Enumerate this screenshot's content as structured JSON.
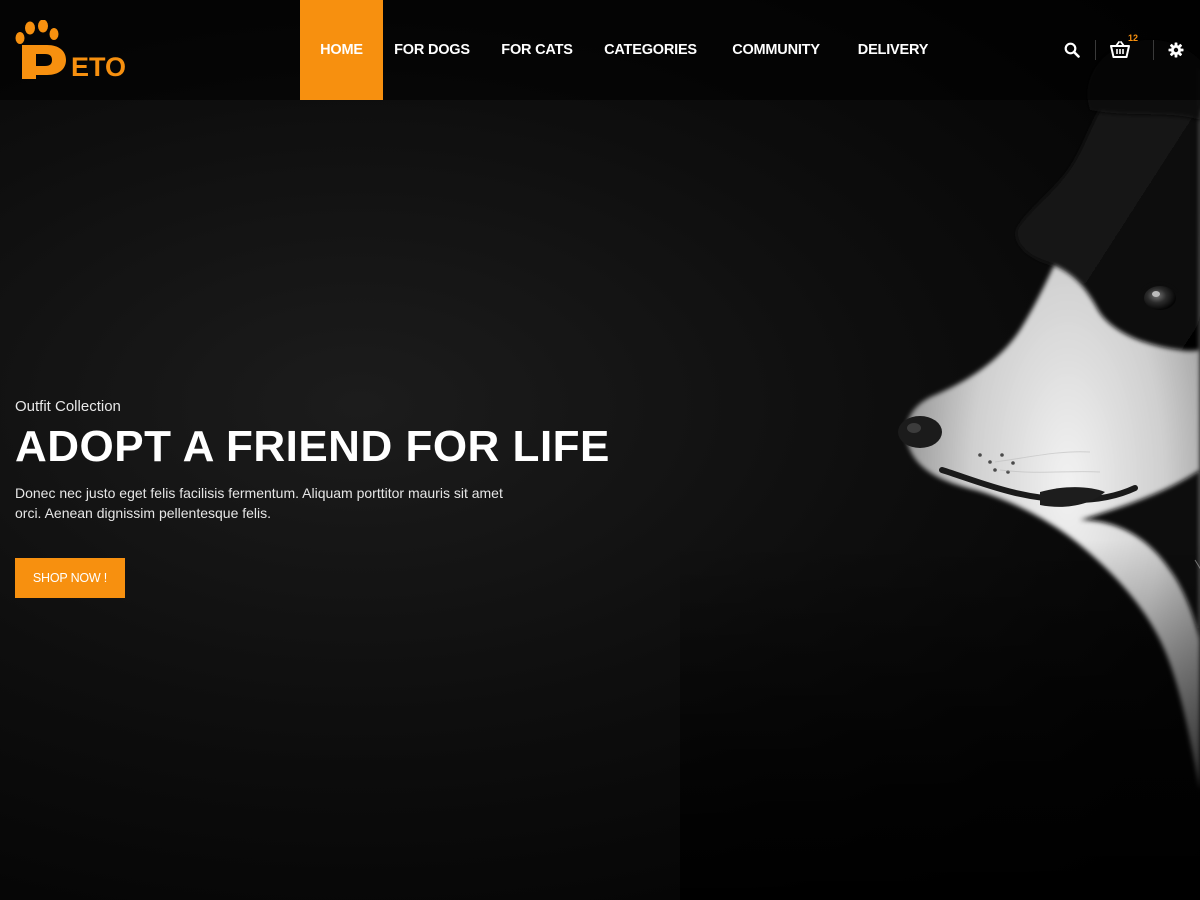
{
  "brand": {
    "logo_text": "ETO",
    "logo_letter": "P",
    "accent_color": "#f7900f"
  },
  "nav": {
    "items": [
      {
        "label": "HOME",
        "active": true
      },
      {
        "label": "FOR DOGS",
        "active": false
      },
      {
        "label": "FOR CATS",
        "active": false
      },
      {
        "label": "CATEGORIES",
        "active": false
      },
      {
        "label": "COMMUNITY",
        "active": false
      },
      {
        "label": "DELIVERY",
        "active": false
      }
    ]
  },
  "tools": {
    "search_icon": "search-icon",
    "cart_icon": "cart-icon",
    "cart_count": "12",
    "settings_icon": "gear-icon"
  },
  "hero": {
    "subtitle": "Outfit Collection",
    "title": "ADOPT A FRIEND FOR LIFE",
    "description": "Donec nec justo eget felis facilisis fermentum. Aliquam porttitor mauris sit amet orci. Aenean dignissim pellentesque felis.",
    "button_label": "SHOP NOW !",
    "image": "dog-profile-photo"
  }
}
